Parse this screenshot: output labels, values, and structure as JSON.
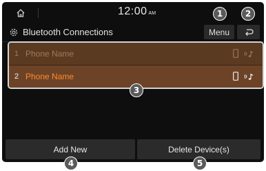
{
  "status": {
    "time": "12:00",
    "ampm": "AM"
  },
  "header": {
    "title": "Bluetooth Connections",
    "menu_label": "Menu"
  },
  "devices": [
    {
      "index": "1",
      "name": "Phone Name",
      "connected": false
    },
    {
      "index": "2",
      "name": "Phone Name",
      "connected": true
    }
  ],
  "buttons": {
    "add_new": "Add New",
    "delete_devices": "Delete Device(s)"
  },
  "callouts": [
    "1",
    "2",
    "3",
    "4",
    "5"
  ],
  "colors": {
    "background": "#0e0e0e",
    "row_active": "#6d4328",
    "row_inactive": "#5b3a22",
    "accent_text": "#ff8a2a",
    "button": "#2b2b2b"
  },
  "icons": [
    "home-icon",
    "settings-icon",
    "back-icon",
    "phone-icon",
    "audio-icon"
  ]
}
